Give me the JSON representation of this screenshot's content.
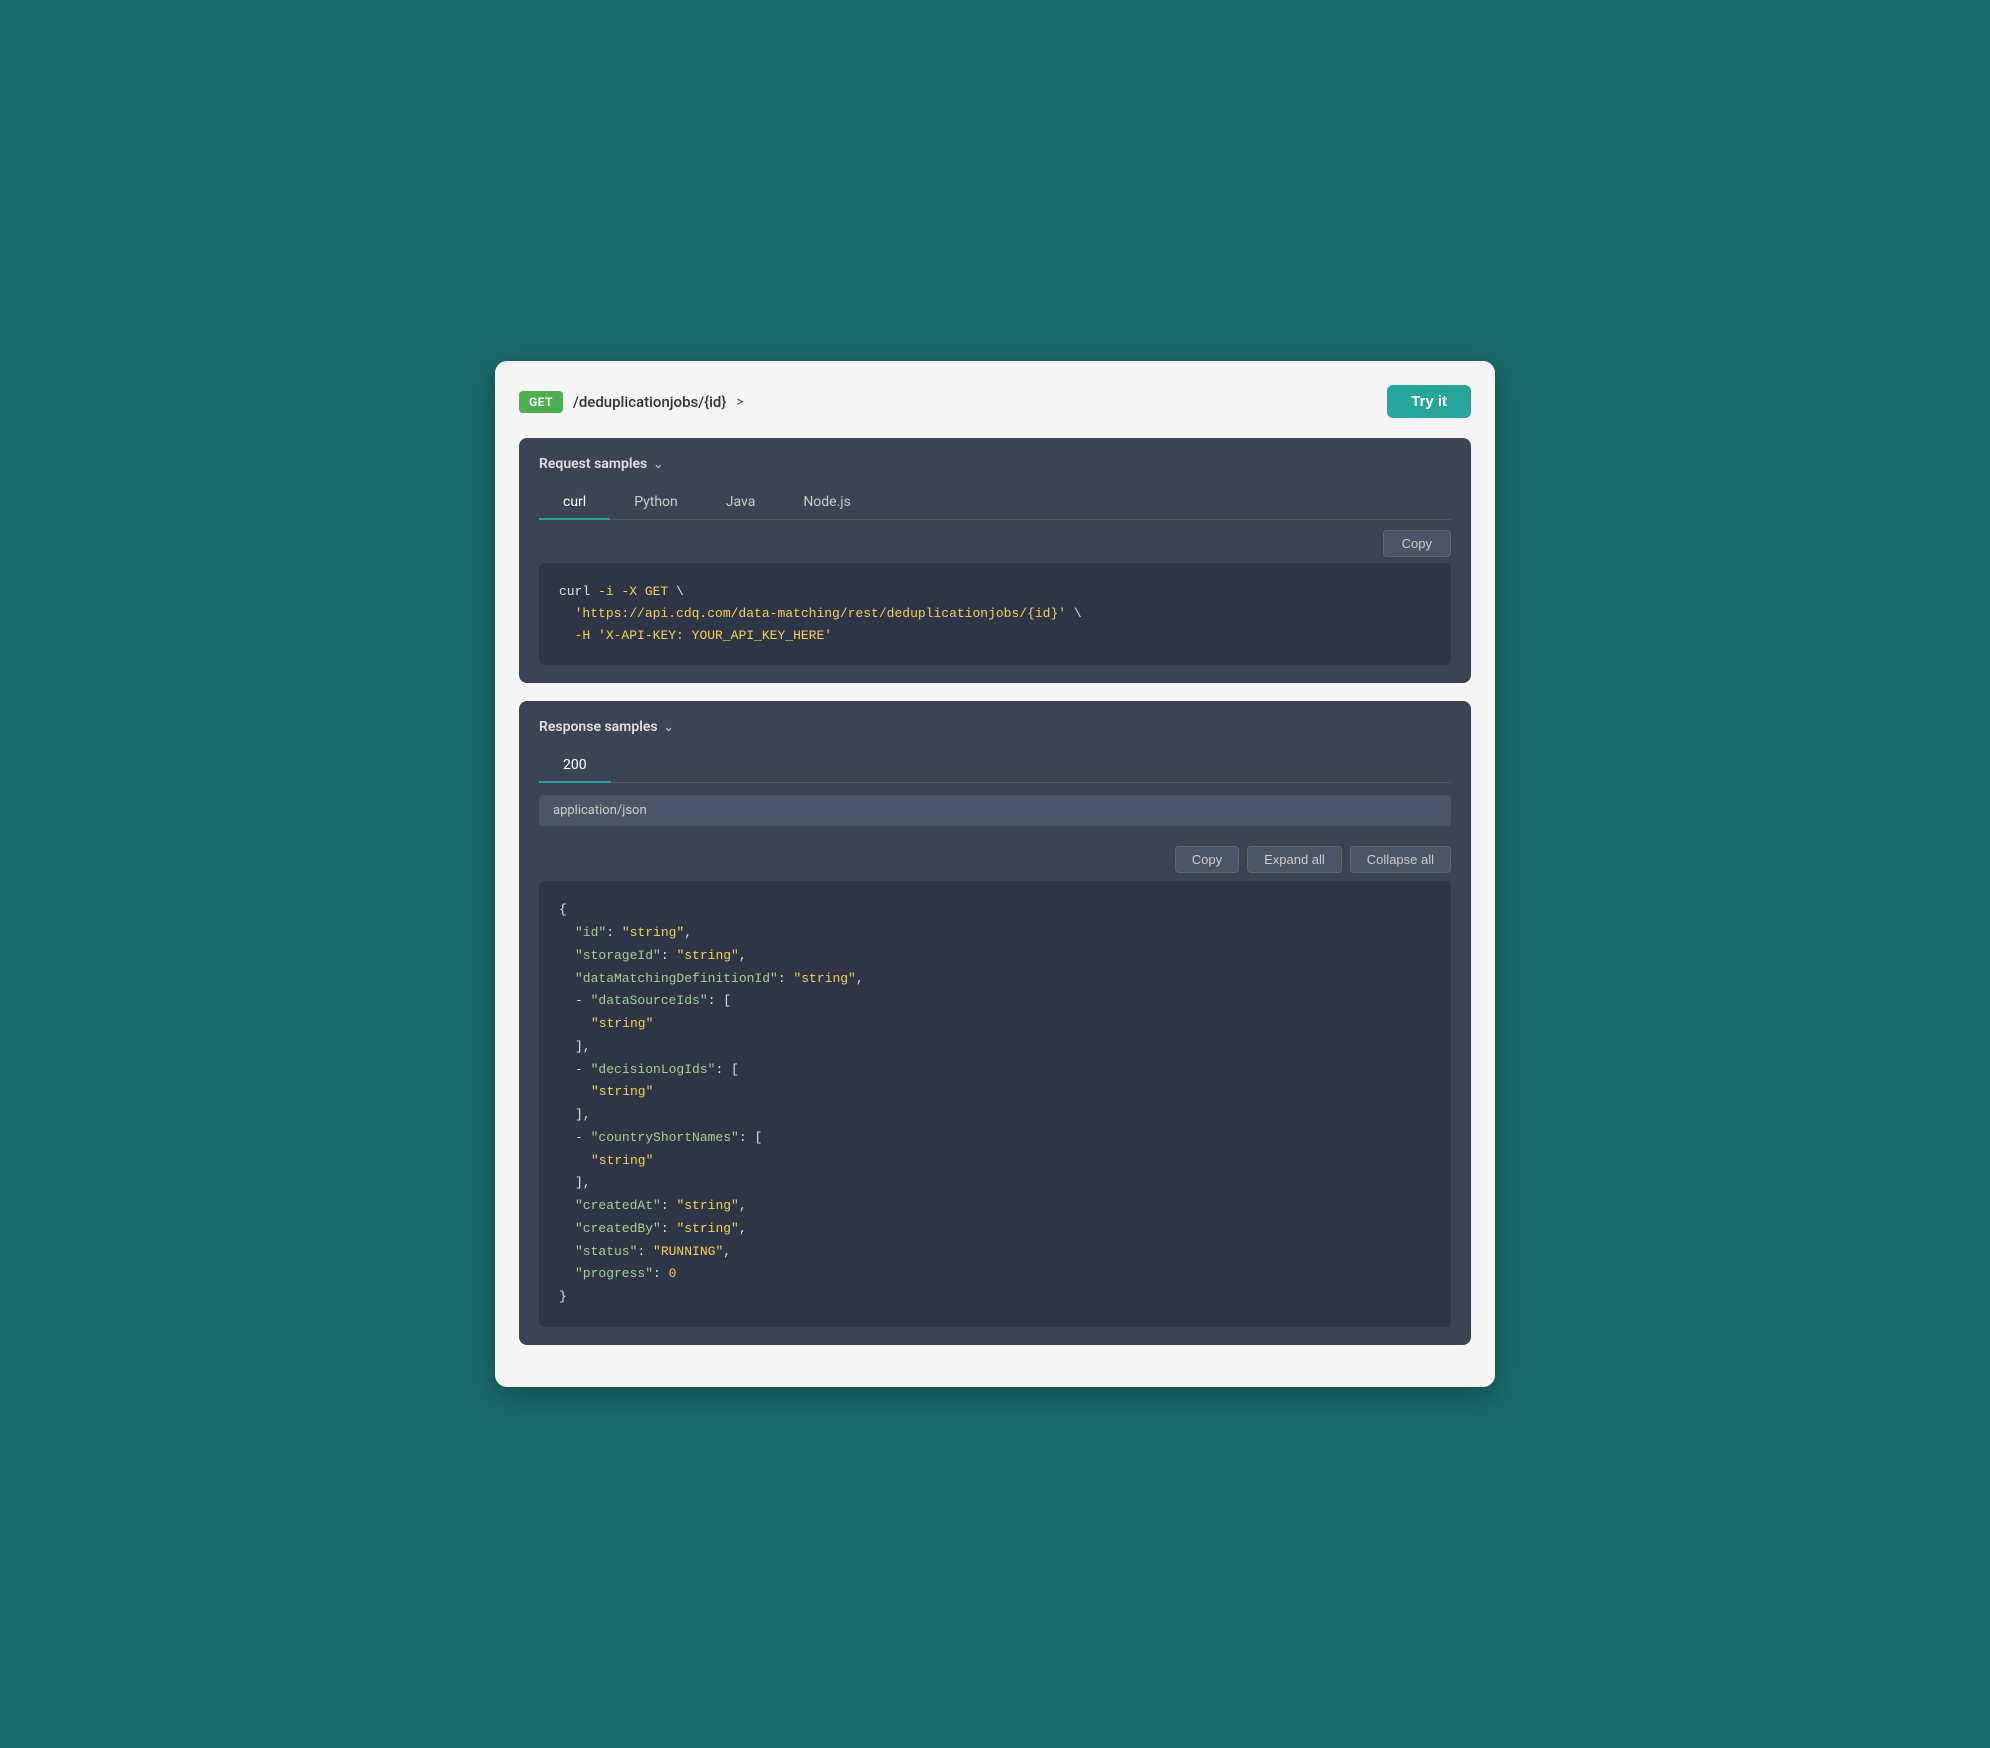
{
  "topbar": {
    "method": "GET",
    "endpoint": "/deduplicationjobs/{id}",
    "chevron": ">",
    "try_it_label": "Try it"
  },
  "request_section": {
    "title": "Request samples",
    "tabs": [
      "curl",
      "Python",
      "Java",
      "Node.js"
    ],
    "active_tab": "curl",
    "copy_label": "Copy",
    "code_lines": [
      {
        "type": "mixed",
        "parts": [
          {
            "color": "white",
            "text": "curl "
          },
          {
            "color": "yellow",
            "text": "-i -X GET"
          },
          {
            "color": "white",
            "text": " \\"
          }
        ]
      },
      {
        "type": "mixed",
        "parts": [
          {
            "color": "white",
            "text": "  "
          },
          {
            "color": "yellow",
            "text": "'https://api.cdq.com/data-matching/rest/deduplicationjobs/{id}'"
          },
          {
            "color": "white",
            "text": " \\"
          }
        ]
      },
      {
        "type": "mixed",
        "parts": [
          {
            "color": "white",
            "text": "  "
          },
          {
            "color": "yellow",
            "text": "-H"
          },
          {
            "color": "white",
            "text": " "
          },
          {
            "color": "yellow",
            "text": "'X-API-KEY: YOUR_API_KEY_HERE'"
          }
        ]
      }
    ]
  },
  "response_section": {
    "title": "Response samples",
    "tabs": [
      "200"
    ],
    "active_tab": "200",
    "content_type": "application/json",
    "copy_label": "Copy",
    "expand_all_label": "Expand all",
    "collapse_all_label": "Collapse all",
    "json_lines": [
      {
        "indent": 0,
        "content": "{",
        "type": "brace"
      },
      {
        "indent": 1,
        "key": "\"id\"",
        "value": "\"string\"",
        "comma": true
      },
      {
        "indent": 1,
        "key": "\"storageId\"",
        "value": "\"string\"",
        "comma": true
      },
      {
        "indent": 1,
        "key": "\"dataMatchingDefinitionId\"",
        "value": "\"string\"",
        "comma": true
      },
      {
        "indent": 1,
        "prefix": "- ",
        "key": "\"dataSourceIds\"",
        "bracket_open": "[",
        "comma": false
      },
      {
        "indent": 2,
        "value": "\"string\"",
        "comma": false
      },
      {
        "indent": 1,
        "content": "],",
        "type": "bracket"
      },
      {
        "indent": 1,
        "prefix": "- ",
        "key": "\"decisionLogIds\"",
        "bracket_open": "[",
        "comma": false
      },
      {
        "indent": 2,
        "value": "\"string\"",
        "comma": false
      },
      {
        "indent": 1,
        "content": "],",
        "type": "bracket"
      },
      {
        "indent": 1,
        "prefix": "- ",
        "key": "\"countryShortNames\"",
        "bracket_open": "[",
        "comma": false
      },
      {
        "indent": 2,
        "value": "\"string\"",
        "comma": false
      },
      {
        "indent": 1,
        "content": "],",
        "type": "bracket"
      },
      {
        "indent": 1,
        "key": "\"createdAt\"",
        "value": "\"string\"",
        "comma": true
      },
      {
        "indent": 1,
        "key": "\"createdBy\"",
        "value": "\"string\"",
        "comma": true
      },
      {
        "indent": 1,
        "key": "\"status\"",
        "value": "\"RUNNING\"",
        "comma": true
      },
      {
        "indent": 1,
        "key": "\"progress\"",
        "value": "0",
        "comma": false
      },
      {
        "indent": 0,
        "content": "}",
        "type": "brace"
      }
    ]
  }
}
